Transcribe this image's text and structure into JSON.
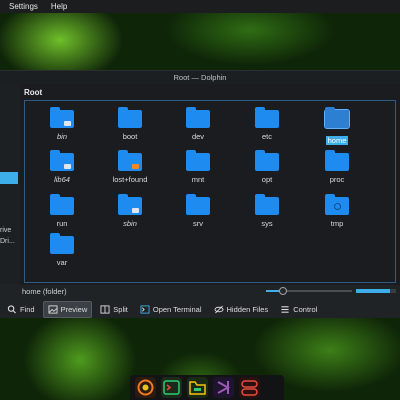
{
  "menubar": {
    "items": [
      "Settings",
      "Help"
    ]
  },
  "window": {
    "title": "Root — Dolphin"
  },
  "sidebar": {
    "labels": [
      "rive",
      "Dri..."
    ]
  },
  "breadcrumb": "Root",
  "folders": [
    {
      "name": "bin",
      "italic": true,
      "emblem": "link",
      "selected": false
    },
    {
      "name": "boot",
      "italic": false,
      "emblem": "",
      "selected": false
    },
    {
      "name": "dev",
      "italic": false,
      "emblem": "",
      "selected": false
    },
    {
      "name": "etc",
      "italic": false,
      "emblem": "",
      "selected": false
    },
    {
      "name": "home",
      "italic": false,
      "emblem": "",
      "selected": true
    },
    {
      "name": "lib64",
      "italic": true,
      "emblem": "link",
      "selected": false
    },
    {
      "name": "lost+found",
      "italic": false,
      "emblem": "lock",
      "selected": false
    },
    {
      "name": "mnt",
      "italic": false,
      "emblem": "",
      "selected": false
    },
    {
      "name": "opt",
      "italic": false,
      "emblem": "",
      "selected": false
    },
    {
      "name": "proc",
      "italic": false,
      "emblem": "",
      "selected": false
    },
    {
      "name": "run",
      "italic": false,
      "emblem": "",
      "selected": false
    },
    {
      "name": "sbin",
      "italic": true,
      "emblem": "link",
      "selected": false
    },
    {
      "name": "srv",
      "italic": false,
      "emblem": "",
      "selected": false
    },
    {
      "name": "sys",
      "italic": false,
      "emblem": "",
      "selected": false
    },
    {
      "name": "tmp",
      "italic": false,
      "emblem": "clock",
      "selected": false
    },
    {
      "name": "var",
      "italic": false,
      "emblem": "",
      "selected": false
    }
  ],
  "status": {
    "text": "home (folder)",
    "zoom_level": 0.2,
    "space_used": 0.85
  },
  "toolbar": {
    "find": "Find",
    "preview": "Preview",
    "split": "Split",
    "open_terminal": "Open Terminal",
    "hidden_files": "Hidden Files",
    "control": "Control"
  },
  "dock": [
    {
      "name": "firefox-icon",
      "color": "#2a1a10"
    },
    {
      "name": "terminal-icon",
      "color": "#1b2a1b"
    },
    {
      "name": "files-icon",
      "color": "#1b2a14"
    },
    {
      "name": "vscode-icon",
      "color": "#1e1430"
    },
    {
      "name": "settings-toggle-icon",
      "color": "#2a1010"
    }
  ],
  "colors": {
    "accent": "#3daee9",
    "folder": "#1e8bf0",
    "window_bg": "#202326"
  }
}
